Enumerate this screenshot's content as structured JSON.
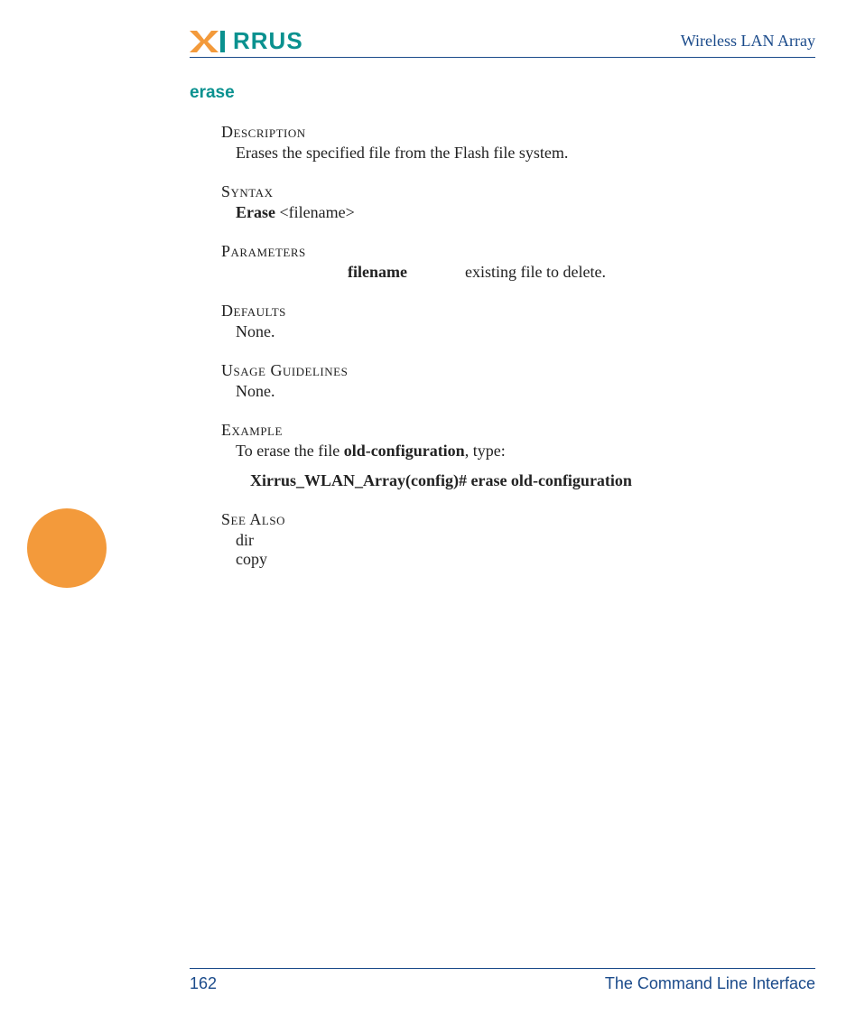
{
  "header": {
    "logo_text": "RRUS",
    "doc_title": "Wireless LAN Array"
  },
  "command": {
    "name": "erase"
  },
  "sections": {
    "description": {
      "label": "Description",
      "text": "Erases the specified file from the Flash file system."
    },
    "syntax": {
      "label": "Syntax",
      "cmd": "Erase",
      "arg": "  <filename>"
    },
    "parameters": {
      "label": "Parameters",
      "name": "filename",
      "desc": "existing file to delete."
    },
    "defaults": {
      "label": "Defaults",
      "text": "None."
    },
    "usage": {
      "label": "Usage Guidelines",
      "text": "None."
    },
    "example": {
      "label": "Example",
      "prefix": "To erase the file ",
      "bold_file": "old-configuration",
      "suffix": ", type:",
      "command_line": "Xirrus_WLAN_Array(config)# erase old-configuration"
    },
    "seealso": {
      "label": "See Also",
      "items": [
        "dir",
        "copy"
      ]
    }
  },
  "footer": {
    "page_number": "162",
    "title": "The Command Line Interface"
  }
}
